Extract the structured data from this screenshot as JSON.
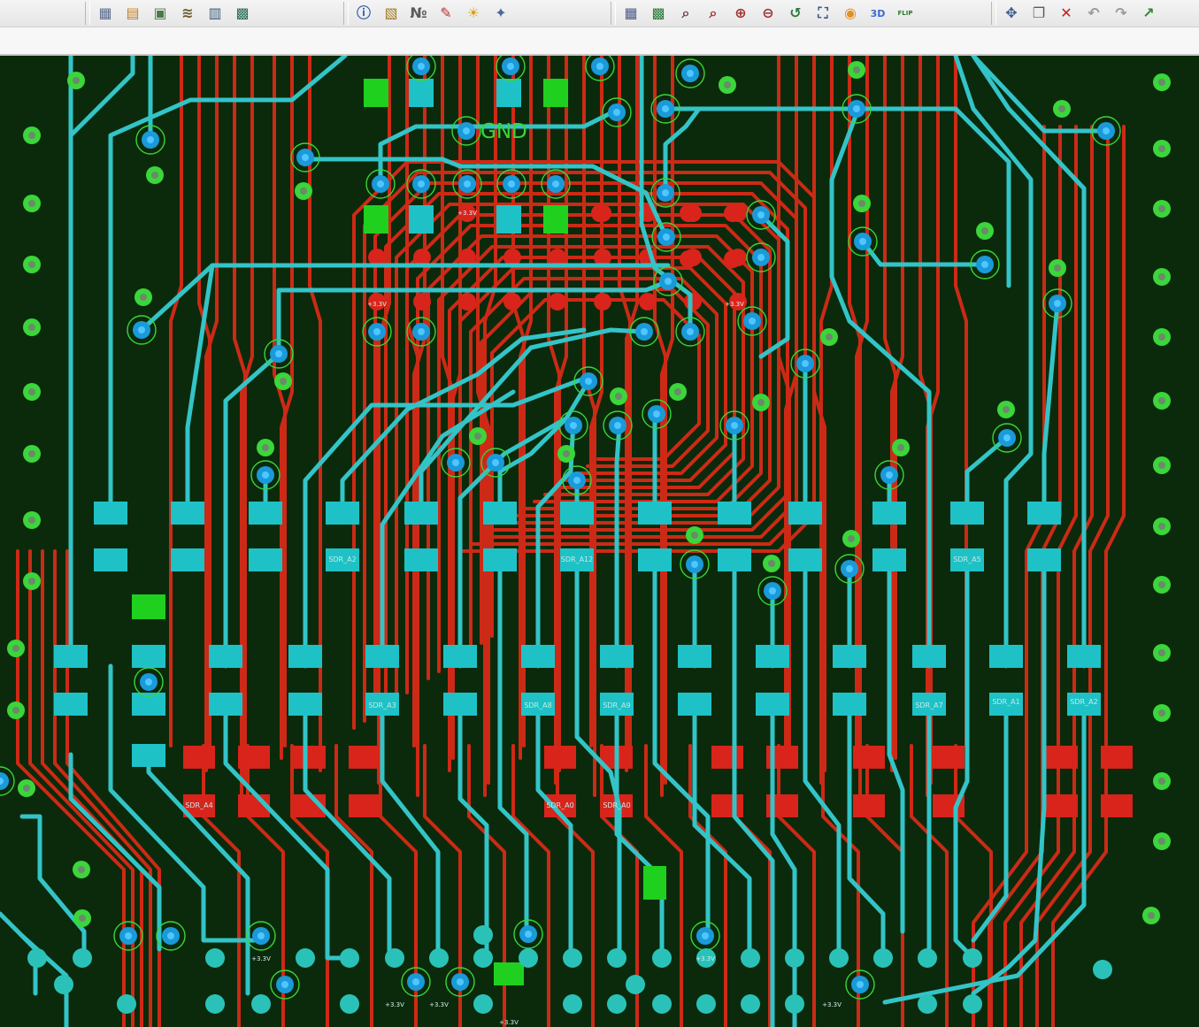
{
  "toolbar": {
    "groups": [
      [
        {
          "name": "grid-icon",
          "glyph": "▦",
          "color": "#5a6a8a"
        },
        {
          "name": "layers-icon",
          "glyph": "▤",
          "color": "#c08020"
        },
        {
          "name": "component-icon",
          "glyph": "▣",
          "color": "#4a7a4a"
        },
        {
          "name": "stack-icon",
          "glyph": "≋",
          "color": "#6a5a2a"
        },
        {
          "name": "sch-icon",
          "glyph": "▥",
          "color": "#3a5a7a"
        },
        {
          "name": "board-icon",
          "glyph": "▩",
          "color": "#2a6a5a"
        }
      ],
      [
        {
          "name": "info-icon",
          "glyph": "ⓘ",
          "color": "#2a5aa8"
        },
        {
          "name": "properties-icon",
          "glyph": "▧",
          "color": "#a07a20"
        },
        {
          "name": "numbering-icon",
          "glyph": "№",
          "color": "#5a5a5a"
        },
        {
          "name": "brush-icon",
          "glyph": "✎",
          "color": "#c03030"
        },
        {
          "name": "highlight-icon",
          "glyph": "☀",
          "color": "#e0a010"
        },
        {
          "name": "probe-icon",
          "glyph": "✦",
          "color": "#4a6a9a"
        }
      ],
      [
        {
          "name": "view-grid-icon",
          "glyph": "▦",
          "color": "#4a5a8a"
        },
        {
          "name": "view-board-icon",
          "glyph": "▩",
          "color": "#2a7a3a"
        },
        {
          "name": "zoom-area-icon",
          "glyph": "⌕",
          "color": "#7a3a3a"
        },
        {
          "name": "zoom-icon",
          "glyph": "⌕",
          "color": "#a03030"
        },
        {
          "name": "zoom-in-icon",
          "glyph": "⊕",
          "color": "#a03030"
        },
        {
          "name": "zoom-out-icon",
          "glyph": "⊖",
          "color": "#a03030"
        },
        {
          "name": "zoom-previous-icon",
          "glyph": "↺",
          "color": "#2a7a3a"
        },
        {
          "name": "zoom-fit-icon",
          "glyph": "⛶",
          "color": "#3a5a8a"
        },
        {
          "name": "refresh-icon",
          "glyph": "◉",
          "color": "#e09020"
        },
        {
          "name": "view-3d-icon",
          "glyph": "3D",
          "color": "#3a6ad0"
        },
        {
          "name": "flip-icon",
          "glyph": "FLIP",
          "color": "#2a7a2a"
        }
      ],
      [
        {
          "name": "move-icon",
          "glyph": "✥",
          "color": "#3a5a8a"
        },
        {
          "name": "copy-icon",
          "glyph": "❐",
          "color": "#5a5a5a"
        },
        {
          "name": "delete-icon",
          "glyph": "✕",
          "color": "#c02020"
        },
        {
          "name": "undo-icon",
          "glyph": "↶",
          "color": "#9a9a9a"
        },
        {
          "name": "redo-icon",
          "glyph": "↷",
          "color": "#9a9a9a"
        },
        {
          "name": "route-icon",
          "glyph": "↗",
          "color": "#2a8a2a"
        }
      ]
    ]
  },
  "colors": {
    "background": "#0b2a0b",
    "trace_top": "#cc2a16",
    "trace_bottom": "#33c4c8",
    "via_ring": "#3ad63a",
    "pad_bottom": "#1ec2c6",
    "pad_top": "#d8241a",
    "pad_green": "#1fd01f"
  },
  "labels": {
    "net_gnd": "GND",
    "parts": [
      "SDR_A2",
      "SDR_A12",
      "SDR_A5",
      "SDR_A3",
      "SDR_A8",
      "SDR_A9",
      "SDR_A7",
      "SDR_A1",
      "SDR_A2",
      "SDR_A4",
      "SDR_A0",
      "SDR_A0"
    ],
    "power": "+3.3V"
  }
}
